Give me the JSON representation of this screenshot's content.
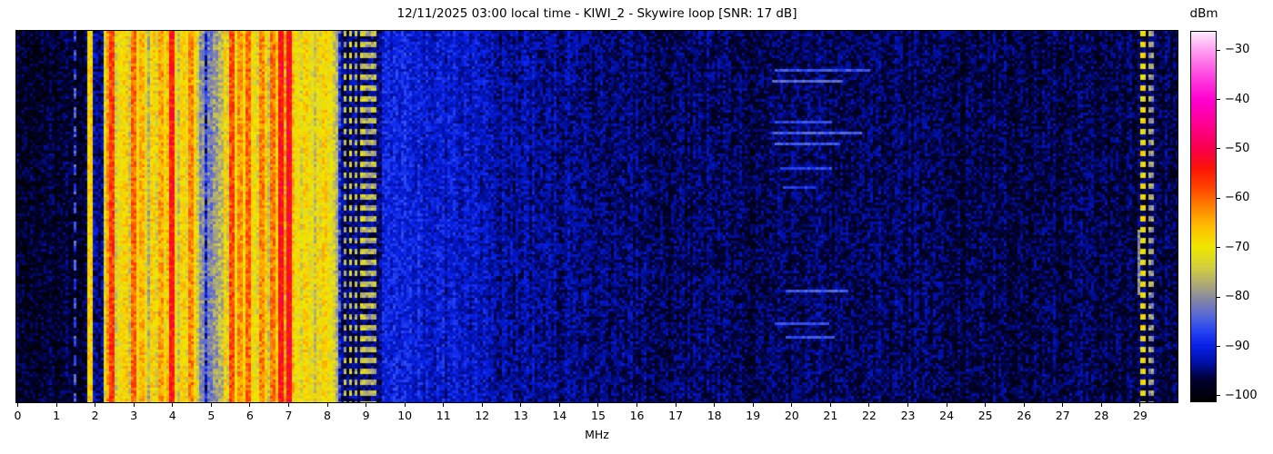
{
  "chart_data": {
    "type": "heatmap",
    "subtype": "radio-spectrogram-waterfall",
    "title": "12/11/2025 03:00 local time - KIWI_2 - Skywire loop [SNR: 17 dB]",
    "station": "KIWI_2",
    "antenna": "Skywire loop",
    "snr_db": 17,
    "x_axis": {
      "label": "MHz",
      "min": 0,
      "max": 30,
      "tick_values": [
        0,
        1,
        2,
        3,
        4,
        5,
        6,
        7,
        8,
        9,
        10,
        11,
        12,
        13,
        14,
        15,
        16,
        17,
        18,
        19,
        20,
        21,
        22,
        23,
        24,
        25,
        26,
        27,
        28,
        29
      ],
      "tick_labels": [
        "0",
        "1",
        "2",
        "3",
        "4",
        "5",
        "6",
        "7",
        "8",
        "9",
        "10",
        "11",
        "12",
        "13",
        "14",
        "15",
        "16",
        "17",
        "18",
        "19",
        "20",
        "21",
        "22",
        "23",
        "24",
        "25",
        "26",
        "27",
        "28",
        "29"
      ]
    },
    "y_axis": {
      "label": "",
      "kind": "time",
      "ticks": []
    },
    "colorbar": {
      "label": "dBm",
      "vmax": -26.2,
      "vmin": -101.3,
      "tick_values": [
        -30,
        -40,
        -50,
        -60,
        -70,
        -80,
        -90,
        -100
      ],
      "tick_labels": [
        "−30",
        "−40",
        "−50",
        "−60",
        "−70",
        "−80",
        "−90",
        "−100"
      ],
      "stops": [
        [
          -101.3,
          "#000000"
        ],
        [
          -97,
          "#000130"
        ],
        [
          -93.5,
          "#0010a8"
        ],
        [
          -90,
          "#0922e8"
        ],
        [
          -87,
          "#2745f2"
        ],
        [
          -84,
          "#5568d8"
        ],
        [
          -81,
          "#8283ab"
        ],
        [
          -78,
          "#a9a67c"
        ],
        [
          -74,
          "#d3cf3e"
        ],
        [
          -70,
          "#efe800"
        ],
        [
          -66,
          "#ffc100"
        ],
        [
          -62,
          "#ff8700"
        ],
        [
          -58,
          "#ff4600"
        ],
        [
          -54,
          "#fd1507"
        ],
        [
          -50,
          "#f8004c"
        ],
        [
          -45,
          "#ff0092"
        ],
        [
          -40,
          "#ff00d0"
        ],
        [
          -35,
          "#ff47e1"
        ],
        [
          -30,
          "#ff9df1"
        ],
        [
          -26.2,
          "#ffe9fd"
        ]
      ]
    },
    "noise_segment_format": [
      "f0_mhz",
      "f1_mhz",
      "level0_dbm",
      "level1_dbm",
      "jitter_db"
    ],
    "noise_segments": [
      [
        0.0,
        1.88,
        -97.5,
        -97.5,
        3.5
      ],
      [
        1.88,
        2.25,
        -95.0,
        -95.0,
        4.0
      ],
      [
        2.25,
        8.35,
        -89.0,
        -89.0,
        7.0
      ],
      [
        8.35,
        9.4,
        -95.5,
        -95.5,
        4.0
      ],
      [
        9.4,
        10.4,
        -90.0,
        -90.0,
        3.5
      ],
      [
        10.4,
        12.3,
        -91.0,
        -92.5,
        3.5
      ],
      [
        12.3,
        16.5,
        -93.5,
        -95.5,
        3.5
      ],
      [
        16.5,
        24.0,
        -96.0,
        -96.0,
        3.5
      ],
      [
        24.0,
        30.0,
        -96.5,
        -96.5,
        3.5
      ]
    ],
    "band_boost_format": [
      "f0_mhz",
      "f1_mhz",
      "boost_db"
    ],
    "band_boosts": [
      [
        2.25,
        3.1,
        3
      ],
      [
        3.1,
        4.4,
        6
      ],
      [
        5.3,
        6.4,
        4
      ],
      [
        6.5,
        7.45,
        5
      ],
      [
        7.45,
        8.3,
        2
      ]
    ],
    "stripe_format": [
      "freq_mhz",
      "width_mhz",
      "level_dbm",
      "style s=solid d=dotted D=dashed",
      "y0_frac(optional)",
      "y1_frac(optional)"
    ],
    "stripes": [
      [
        1.48,
        0.05,
        -86,
        "D"
      ],
      [
        1.9,
        0.07,
        -68,
        "s"
      ],
      [
        2.28,
        0.06,
        -72,
        "s"
      ],
      [
        2.36,
        0.06,
        -63,
        "s"
      ],
      [
        2.44,
        0.07,
        -57,
        "s"
      ],
      [
        2.52,
        0.05,
        -74,
        "s"
      ],
      [
        2.62,
        0.06,
        -70,
        "s"
      ],
      [
        2.72,
        0.06,
        -78,
        "s"
      ],
      [
        2.8,
        0.06,
        -68,
        "s"
      ],
      [
        2.9,
        0.05,
        -74,
        "s"
      ],
      [
        3.0,
        0.07,
        -60,
        "s"
      ],
      [
        3.08,
        0.06,
        -70,
        "s"
      ],
      [
        3.18,
        0.07,
        -65,
        "s"
      ],
      [
        3.28,
        0.06,
        -71,
        "s"
      ],
      [
        3.38,
        0.06,
        -77,
        "s"
      ],
      [
        3.48,
        0.07,
        -68,
        "s"
      ],
      [
        3.58,
        0.06,
        -73,
        "s"
      ],
      [
        3.68,
        0.07,
        -64,
        "s"
      ],
      [
        3.78,
        0.06,
        -70,
        "s"
      ],
      [
        3.88,
        0.06,
        -66,
        "s"
      ],
      [
        3.96,
        0.08,
        -54,
        "s"
      ],
      [
        4.06,
        0.06,
        -70,
        "s"
      ],
      [
        4.16,
        0.06,
        -75,
        "s"
      ],
      [
        4.26,
        0.06,
        -68,
        "s"
      ],
      [
        4.36,
        0.06,
        -72,
        "s"
      ],
      [
        4.46,
        0.07,
        -62,
        "s"
      ],
      [
        4.56,
        0.06,
        -69,
        "s"
      ],
      [
        4.66,
        0.05,
        -74,
        "s"
      ],
      [
        4.78,
        0.05,
        -80,
        "s"
      ],
      [
        4.95,
        0.05,
        -82,
        "s"
      ],
      [
        5.1,
        0.05,
        -79,
        "s"
      ],
      [
        5.25,
        0.06,
        -76,
        "s"
      ],
      [
        5.36,
        0.06,
        -68,
        "s"
      ],
      [
        5.46,
        0.06,
        -73,
        "s"
      ],
      [
        5.56,
        0.07,
        -58,
        "s"
      ],
      [
        5.66,
        0.06,
        -71,
        "s"
      ],
      [
        5.76,
        0.06,
        -63,
        "s"
      ],
      [
        5.88,
        0.06,
        -69,
        "s"
      ],
      [
        5.98,
        0.07,
        -60,
        "s"
      ],
      [
        6.08,
        0.06,
        -70,
        "s"
      ],
      [
        6.18,
        0.06,
        -73,
        "s"
      ],
      [
        6.28,
        0.07,
        -62,
        "s"
      ],
      [
        6.38,
        0.06,
        -68,
        "s"
      ],
      [
        6.48,
        0.06,
        -75,
        "s"
      ],
      [
        6.58,
        0.07,
        -61,
        "s"
      ],
      [
        6.7,
        0.06,
        -68,
        "s"
      ],
      [
        6.8,
        0.08,
        -53,
        "s"
      ],
      [
        6.92,
        0.06,
        -64,
        "s"
      ],
      [
        7.02,
        0.07,
        -52,
        "s"
      ],
      [
        7.12,
        0.06,
        -66,
        "s"
      ],
      [
        7.22,
        0.06,
        -70,
        "s"
      ],
      [
        7.32,
        0.06,
        -73,
        "s"
      ],
      [
        7.42,
        0.06,
        -68,
        "s"
      ],
      [
        7.55,
        0.06,
        -71,
        "s"
      ],
      [
        7.65,
        0.06,
        -75,
        "s"
      ],
      [
        7.75,
        0.06,
        -69,
        "s"
      ],
      [
        7.85,
        0.06,
        -72,
        "s"
      ],
      [
        7.95,
        0.06,
        -68,
        "s"
      ],
      [
        8.05,
        0.06,
        -71,
        "s"
      ],
      [
        8.15,
        0.05,
        -74,
        "s"
      ],
      [
        8.25,
        0.05,
        -77,
        "s"
      ],
      [
        8.45,
        0.05,
        -76,
        "d"
      ],
      [
        8.6,
        0.05,
        -73,
        "d"
      ],
      [
        8.74,
        0.05,
        -77,
        "d"
      ],
      [
        8.9,
        0.05,
        -74,
        "d"
      ],
      [
        9.05,
        0.05,
        -78,
        "d"
      ],
      [
        9.2,
        0.05,
        -76,
        "d"
      ],
      [
        28.95,
        0.04,
        -80,
        "s",
        0.54,
        0.7
      ],
      [
        29.06,
        0.05,
        -70,
        "d"
      ],
      [
        29.28,
        0.05,
        -79,
        "d"
      ]
    ],
    "horizontal_streak_format": [
      "y_frac",
      "f0_mhz",
      "f1_mhz",
      "level_dbm"
    ],
    "horizontal_streaks": [
      [
        0.105,
        19.6,
        22.0,
        -86
      ],
      [
        0.13,
        19.5,
        21.3,
        -84
      ],
      [
        0.245,
        19.6,
        21.0,
        -87
      ],
      [
        0.275,
        19.5,
        21.8,
        -85
      ],
      [
        0.305,
        19.6,
        21.2,
        -86
      ],
      [
        0.37,
        19.7,
        21.0,
        -87
      ],
      [
        0.42,
        19.8,
        20.6,
        -88
      ],
      [
        0.7,
        19.9,
        21.4,
        -85
      ],
      [
        0.785,
        19.6,
        20.9,
        -87
      ],
      [
        0.82,
        19.9,
        21.1,
        -86
      ]
    ]
  }
}
